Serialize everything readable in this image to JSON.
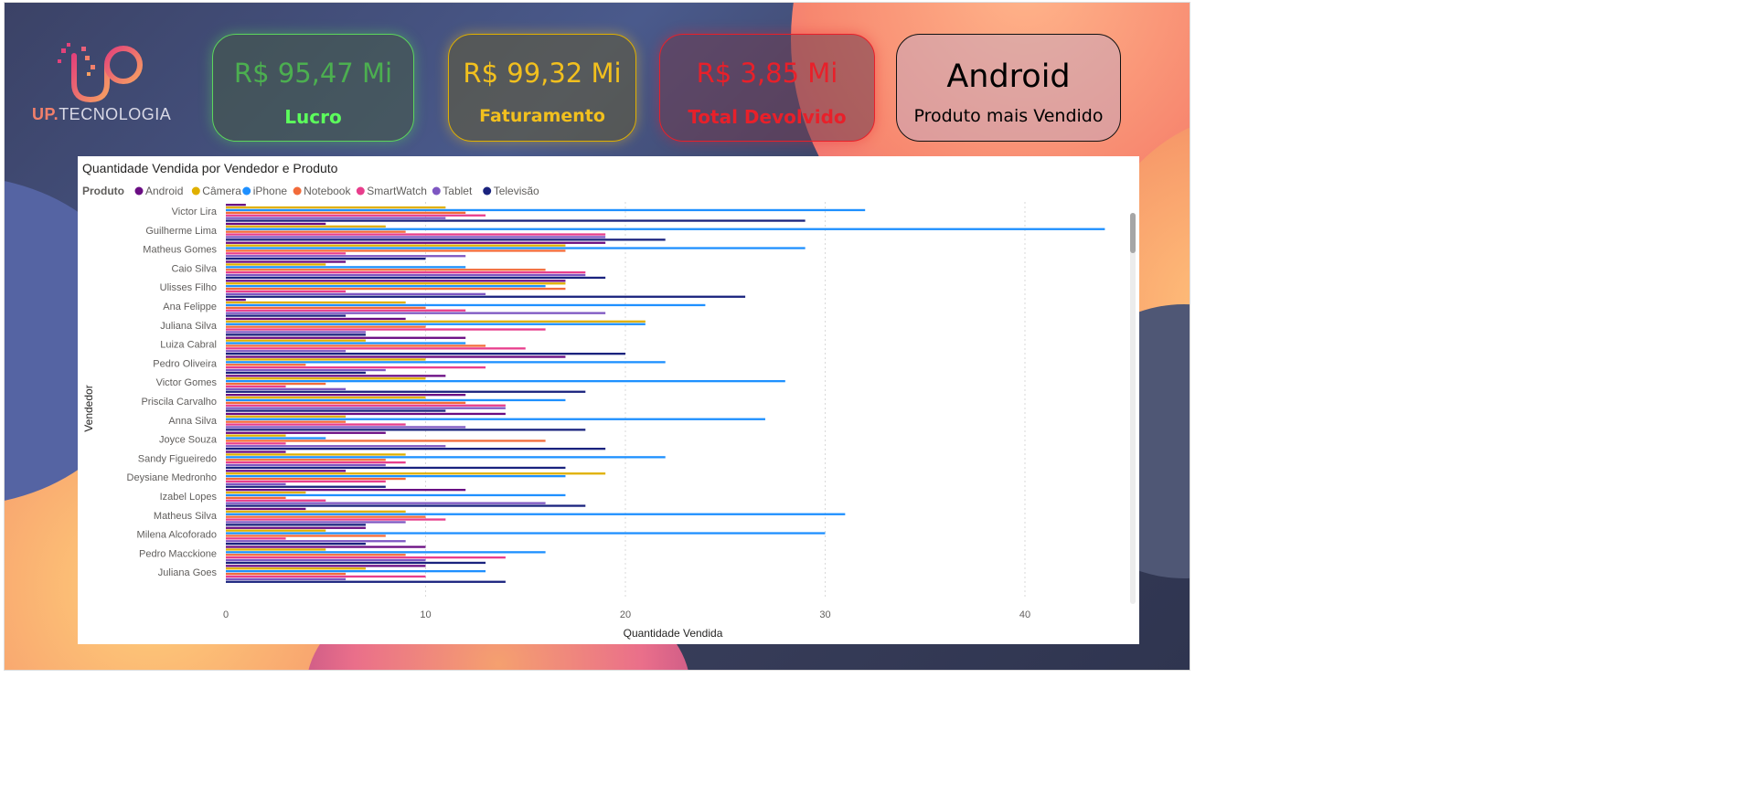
{
  "brand": {
    "prefix": "UP.",
    "name": "TECNOLOGIA"
  },
  "kpis": [
    {
      "value": "R$ 95,47 Mi",
      "label": "Lucro",
      "color": "#5cd65c"
    },
    {
      "value": "R$ 99,32 Mi",
      "label": "Faturamento",
      "color": "#f2c01e"
    },
    {
      "value": "R$ 3,85 Mi",
      "label": "Total Devolvido",
      "color": "#e8202a"
    },
    {
      "value": "Android",
      "label": "Produto mais Vendido",
      "color": "#000000"
    }
  ],
  "chart_data": {
    "type": "bar",
    "orientation": "horizontal",
    "title": "Quantidade Vendida por Vendedor e Produto",
    "legend_title": "Produto",
    "legend_position": "top-left",
    "xlabel": "Quantidade Vendida",
    "ylabel": "Vendedor",
    "xlim": [
      0,
      45
    ],
    "xticks": [
      0,
      10,
      20,
      30,
      40
    ],
    "grid": true,
    "categories": [
      "Victor Lira",
      "Guilherme Lima",
      "Matheus Gomes",
      "Caio Silva",
      "Ulisses Filho",
      "Ana Felippe",
      "Juliana Silva",
      "Luiza Cabral",
      "Pedro Oliveira",
      "Victor Gomes",
      "Priscila Carvalho",
      "Anna Silva",
      "Joyce Souza",
      "Sandy Figueiredo",
      "Deysiane Medronho",
      "Izabel Lopes",
      "Matheus Silva",
      "Milena Alcoforado",
      "Pedro Macckione",
      "Juliana Goes"
    ],
    "series": [
      {
        "name": "Android",
        "color": "#6a0d83",
        "values": [
          1,
          5,
          19,
          6,
          17,
          1,
          9,
          12,
          17,
          11,
          12,
          14,
          8,
          3,
          6,
          12,
          4,
          7,
          10,
          10
        ]
      },
      {
        "name": "Câmera",
        "color": "#e0b000",
        "values": [
          11,
          8,
          17,
          5,
          17,
          9,
          21,
          7,
          10,
          10,
          10,
          6,
          3,
          9,
          19,
          4,
          9,
          5,
          5,
          7
        ]
      },
      {
        "name": "iPhone",
        "color": "#1e90ff",
        "values": [
          32,
          44,
          29,
          12,
          16,
          24,
          21,
          12,
          22,
          28,
          17,
          27,
          5,
          22,
          17,
          17,
          31,
          30,
          16,
          13
        ]
      },
      {
        "name": "Notebook",
        "color": "#f26b3a",
        "values": [
          12,
          9,
          17,
          16,
          17,
          10,
          10,
          13,
          4,
          5,
          12,
          6,
          16,
          8,
          9,
          3,
          10,
          8,
          9,
          6
        ]
      },
      {
        "name": "SmartWatch",
        "color": "#e83e8c",
        "values": [
          13,
          19,
          6,
          18,
          6,
          12,
          16,
          15,
          13,
          3,
          14,
          9,
          3,
          9,
          8,
          5,
          11,
          3,
          14,
          10
        ]
      },
      {
        "name": "Tablet",
        "color": "#7e57c2",
        "values": [
          11,
          19,
          12,
          18,
          13,
          19,
          7,
          6,
          8,
          6,
          14,
          12,
          11,
          8,
          3,
          16,
          9,
          9,
          10,
          6
        ]
      },
      {
        "name": "Televisão",
        "color": "#1a237e",
        "values": [
          29,
          22,
          10,
          19,
          26,
          6,
          7,
          20,
          7,
          18,
          11,
          18,
          19,
          17,
          8,
          18,
          7,
          7,
          13,
          14
        ]
      }
    ]
  }
}
